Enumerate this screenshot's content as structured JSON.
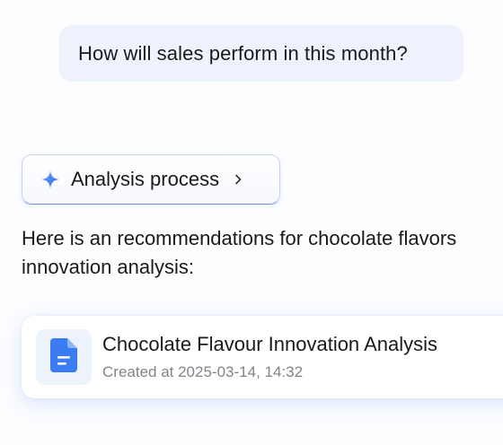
{
  "user_message": {
    "text": "How will sales perform in this month?"
  },
  "analysis_chip": {
    "label": "Analysis process",
    "icon": "sparkle-icon",
    "chevron_icon": "chevron-right-icon"
  },
  "assistant_message": {
    "text": "Here is an recommendations for chocolate flavors innovation analysis:"
  },
  "document_card": {
    "icon": "document-icon",
    "title": "Chocolate Flavour Innovation Analysis",
    "created_label": "Created at 2025-03-14, 14:32"
  },
  "colors": {
    "accent": "#3b7cf2",
    "user_bubble_bg": "#eef2fc",
    "meta_text": "#808389"
  }
}
